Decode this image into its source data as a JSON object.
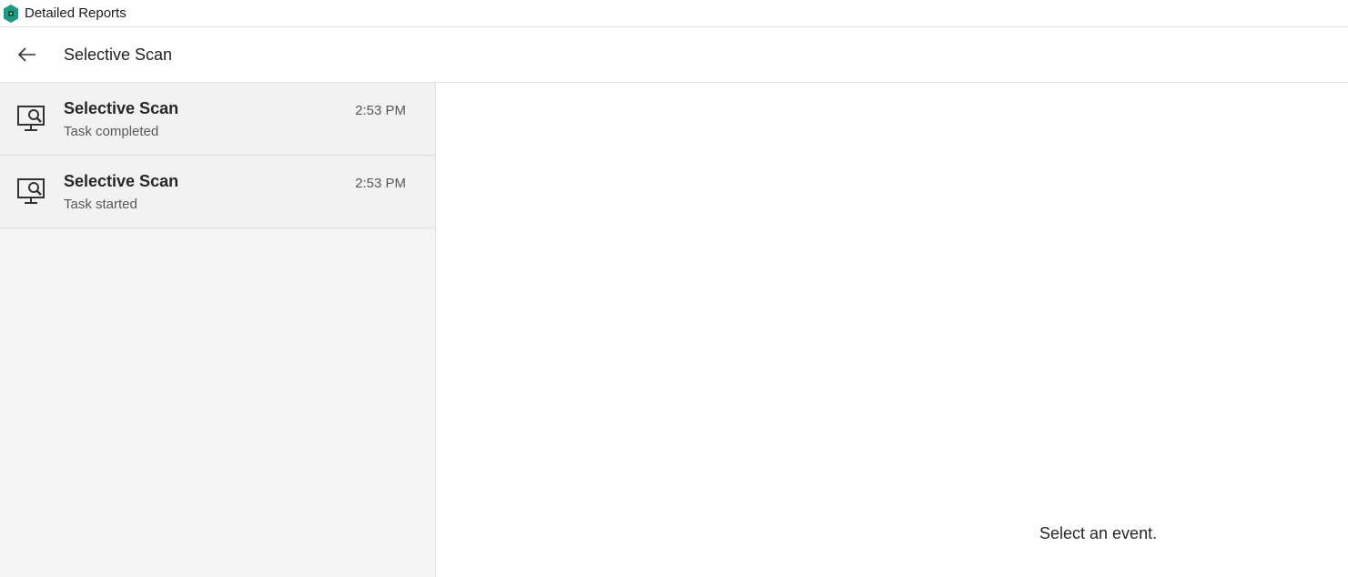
{
  "window": {
    "title": "Detailed Reports"
  },
  "header": {
    "title": "Selective Scan"
  },
  "events": [
    {
      "title": "Selective Scan",
      "status": "Task completed",
      "time": "2:53 PM"
    },
    {
      "title": "Selective Scan",
      "status": "Task started",
      "time": "2:53 PM"
    }
  ],
  "detail": {
    "empty_message": "Select an event."
  },
  "icons": {
    "app": "kaspersky-logo-icon",
    "back": "back-arrow-icon",
    "event": "monitor-search-icon"
  },
  "colors": {
    "accent": "#1a9c82",
    "pane_bg": "#f5f5f5"
  }
}
